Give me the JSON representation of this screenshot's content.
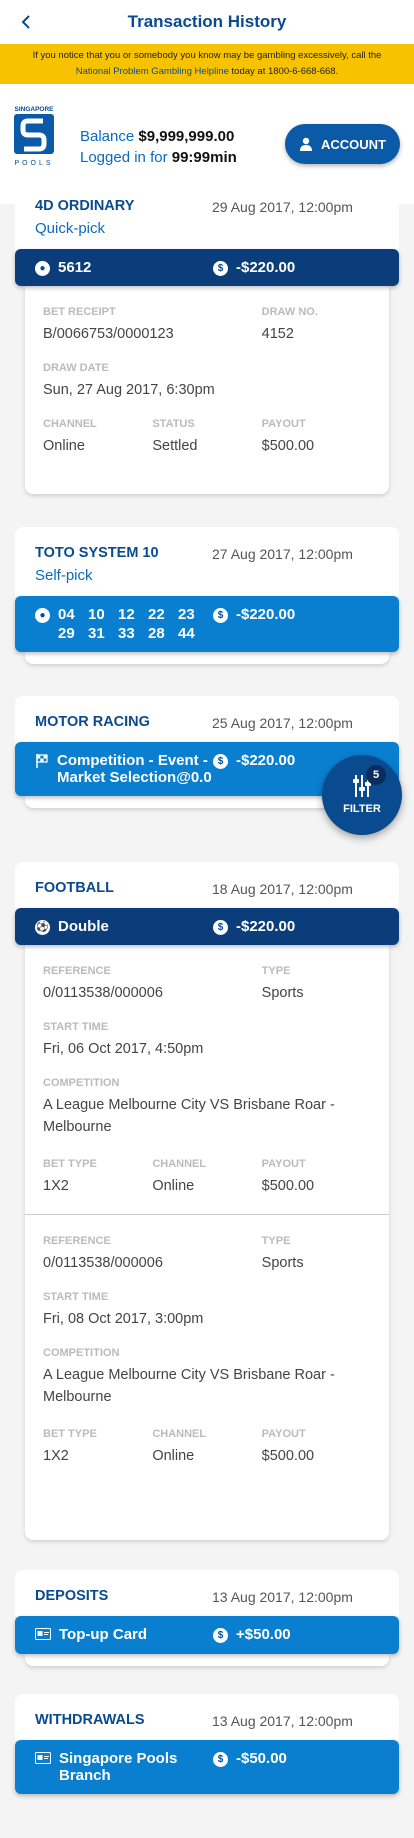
{
  "header": {
    "title": "Transaction History"
  },
  "notice": {
    "text_before": "If you notice that you or somebody you know may be gambling excessively, call the",
    "link_text": "National Problem Gambling Helpline",
    "text_after": "today at 1800-6-668-668."
  },
  "account": {
    "balance_label": "Balance",
    "balance_value": "$9,999,999.00",
    "logged_label": "Logged in for",
    "logged_value": "99:99min",
    "button_label": "ACCOUNT",
    "logo_text_top": "SINGAPORE",
    "logo_text_bottom": "POOLS"
  },
  "filter": {
    "label": "FILTER",
    "count": "5"
  },
  "transactions": [
    {
      "game": "4D ORDINARY",
      "sub": "Quick-pick",
      "date": "29 Aug 2017, 12:00pm",
      "selection": "5612",
      "amount": "-$220.00",
      "details": {
        "f1": "BET RECEIPT",
        "v1": "B/0066753/0000123",
        "f2": "DRAW NO.",
        "v2": "4152",
        "f3": "DRAW DATE",
        "v3": "Sun, 27 Aug 2017, 6:30pm",
        "f4": "CHANNEL",
        "v4": "Online",
        "f5": "STATUS",
        "v5": "Settled",
        "f6": "PAYOUT",
        "v6": "$500.00"
      }
    },
    {
      "game": "TOTO SYSTEM 10",
      "sub": "Self-pick",
      "date": "27 Aug 2017, 12:00pm",
      "numbers": [
        "04",
        "10",
        "12",
        "22",
        "23",
        "29",
        "31",
        "33",
        "28",
        "44"
      ],
      "amount": "-$220.00"
    },
    {
      "game": "MOTOR RACING",
      "date": "25 Aug 2017, 12:00pm",
      "selection": "Competition - Event - Market Selection@0.0",
      "amount": "-$220.00"
    },
    {
      "game": "FOOTBALL",
      "date": "18 Aug 2017, 12:00pm",
      "selection": "Double",
      "amount": "-$220.00",
      "legs": [
        {
          "f_ref": "REFERENCE",
          "ref": "0/0113538/000006",
          "f_type": "TYPE",
          "type": "Sports",
          "f_start": "START TIME",
          "start": "Fri, 06 Oct 2017, 4:50pm",
          "f_comp": "COMPETITION",
          "comp": "A League Melbourne City VS Brisbane Roar - Melbourne",
          "f_bt": "BET TYPE",
          "bt": "1X2",
          "f_ch": "CHANNEL",
          "ch": "Online",
          "f_po": "PAYOUT",
          "po": "$500.00"
        },
        {
          "f_ref": "REFERENCE",
          "ref": "0/0113538/000006",
          "f_type": "TYPE",
          "type": "Sports",
          "f_start": "START TIME",
          "start": "Fri, 08 Oct 2017, 3:00pm",
          "f_comp": "COMPETITION",
          "comp": "A League Melbourne City VS Brisbane Roar - Melbourne",
          "f_bt": "BET TYPE",
          "bt": "1X2",
          "f_ch": "CHANNEL",
          "ch": "Online",
          "f_po": "PAYOUT",
          "po": "$500.00"
        }
      ]
    },
    {
      "game": "DEPOSITS",
      "date": "13 Aug 2017, 12:00pm",
      "selection": "Top-up Card",
      "amount": "+$50.00"
    },
    {
      "game": "WITHDRAWALS",
      "date": "13 Aug 2017, 12:00pm",
      "selection": "Singapore Pools Branch",
      "amount": "-$50.00"
    }
  ],
  "colors": {
    "primary": "#0a4a8f",
    "bar_dark": "#0a3d7a",
    "bar_light": "#0a7fd0",
    "notice": "#f7c300"
  }
}
